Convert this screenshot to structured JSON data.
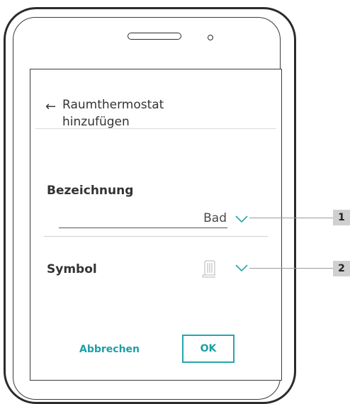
{
  "header": {
    "back_icon": "arrow-left-icon",
    "title_line1": "Raumthermostat",
    "title_line2": "hinzufügen"
  },
  "form": {
    "name_label": "Bezeichnung",
    "name_value": "Bad",
    "symbol_label": "Symbol",
    "symbol_icon": "radiator-icon",
    "dropdown_icon": "chevron-down-icon"
  },
  "actions": {
    "cancel_label": "Abbrechen",
    "ok_label": "OK"
  },
  "callouts": [
    "1",
    "2"
  ],
  "colors": {
    "accent": "#27a5ad",
    "callout_bg": "#cfcfcf"
  }
}
